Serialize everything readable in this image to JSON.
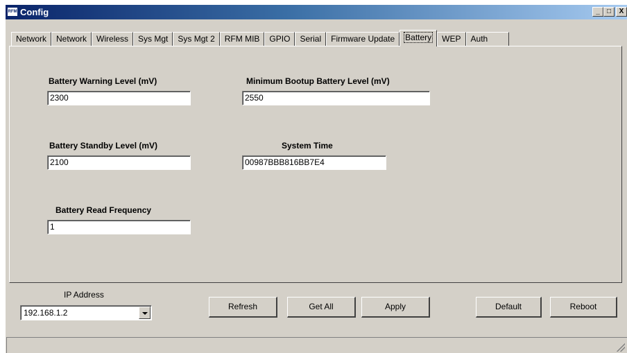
{
  "window": {
    "title": "Config",
    "icon_text": "RFM",
    "controls": {
      "minimize": "_",
      "maximize": "□",
      "close": "X"
    }
  },
  "tabs": [
    {
      "label": "Network",
      "active": false
    },
    {
      "label": "Network",
      "active": false
    },
    {
      "label": "Wireless",
      "active": false
    },
    {
      "label": "Sys Mgt",
      "active": false
    },
    {
      "label": "Sys Mgt 2",
      "active": false
    },
    {
      "label": "RFM MIB",
      "active": false
    },
    {
      "label": "GPIO",
      "active": false
    },
    {
      "label": "Serial",
      "active": false
    },
    {
      "label": "Firmware Update",
      "active": false
    },
    {
      "label": "Battery",
      "active": true
    },
    {
      "label": "WEP",
      "active": false
    },
    {
      "label": "Auth",
      "active": false
    }
  ],
  "battery": {
    "warning_label": "Battery Warning Level (mV)",
    "warning_value": "2300",
    "min_bootup_label": "Minimum Bootup Battery Level (mV)",
    "min_bootup_value": "2550",
    "standby_label": "Battery Standby Level (mV)",
    "standby_value": "2100",
    "system_time_label": "System Time",
    "system_time_value": "00987BBB816BB7E4",
    "read_freq_label": "Battery Read Frequency",
    "read_freq_value": "1"
  },
  "footer": {
    "ip_label": "IP Address",
    "ip_value": "192.168.1.2",
    "refresh_label": "Refresh",
    "get_all_label": "Get All",
    "apply_label": "Apply",
    "default_label": "Default",
    "reboot_label": "Reboot"
  }
}
